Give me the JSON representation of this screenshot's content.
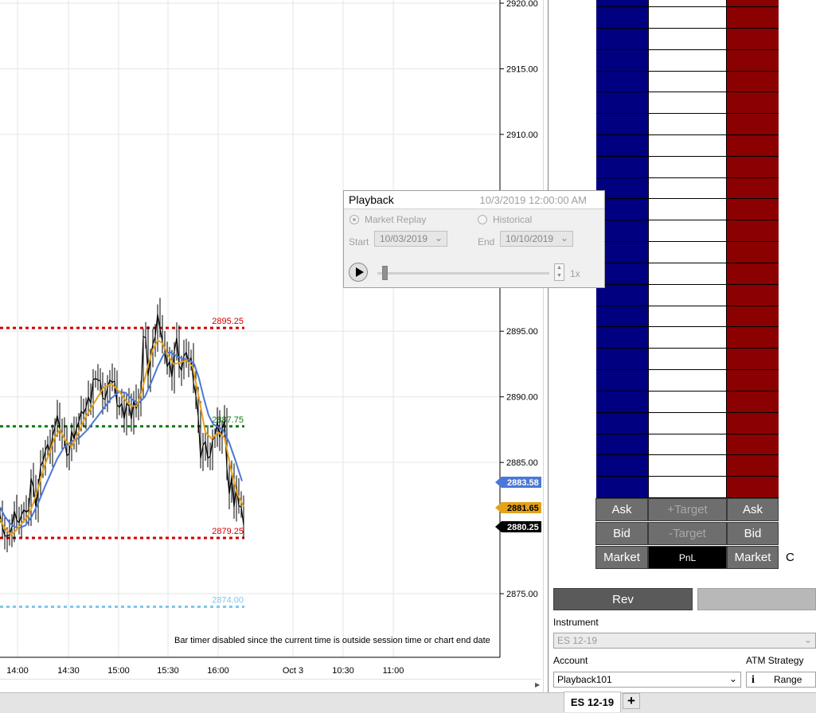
{
  "chart": {
    "price_axis": {
      "min": 2871.0,
      "max": 2920.0,
      "ticks": [
        "2920.00",
        "2915.00",
        "2910.00",
        "2895.00",
        "2890.00",
        "2885.00",
        "2875.00"
      ]
    },
    "time_axis": [
      "14:00",
      "14:30",
      "15:00",
      "15:30",
      "16:00",
      "Oct 3",
      "10:30",
      "11:00"
    ],
    "levels": [
      {
        "label": "2895.25",
        "price": 2895.25,
        "color": "#d40000"
      },
      {
        "label": "2887.75",
        "price": 2887.75,
        "color": "#0f7a0f"
      },
      {
        "label": "2879.25",
        "price": 2879.25,
        "color": "#d40000"
      },
      {
        "label": "2874.00",
        "price": 2874.0,
        "color": "#7ec8f0"
      }
    ],
    "price_tags": [
      {
        "label": "2883.58",
        "price": 2883.58,
        "bg": "#4a78d8",
        "fg": "#ffffff"
      },
      {
        "label": "2881.65",
        "price": 2881.65,
        "bg": "#e3a21a",
        "fg": "#000000"
      },
      {
        "label": "2880.25",
        "price": 2880.25,
        "bg": "#000000",
        "fg": "#ffffff"
      }
    ],
    "bar_timer_note": "Bar timer disabled since the current time is outside session time or chart end date",
    "colors": {
      "price": "#000000",
      "fast_ma": "#e3a21a",
      "slow_ma": "#4a78d8",
      "grid": "#e6e6e6"
    }
  },
  "chart_data": {
    "type": "line",
    "title": "",
    "xlabel": "",
    "ylabel": "",
    "x_ticks": [
      "14:00",
      "14:30",
      "15:00",
      "15:30",
      "16:00",
      "Oct 3",
      "10:30",
      "11:00"
    ],
    "ylim": [
      2871,
      2920
    ],
    "grid": true,
    "series": [
      {
        "key": "price",
        "x": [
          0,
          3,
          6,
          9,
          12,
          15,
          18,
          21,
          24,
          27,
          30,
          33,
          36,
          39,
          42,
          45,
          48,
          51,
          54,
          57,
          60,
          63,
          66,
          69,
          72,
          75,
          78,
          81,
          84,
          87,
          90,
          93,
          96,
          99,
          102,
          105,
          108,
          111,
          114,
          117,
          120,
          123,
          126,
          129,
          132,
          135,
          138,
          141,
          144,
          147,
          150,
          153,
          156,
          159,
          162,
          165,
          168,
          171,
          174,
          177,
          180,
          183,
          186,
          189,
          192,
          195,
          198,
          201,
          204,
          207,
          210,
          213,
          216,
          219,
          222,
          225,
          228,
          231,
          234,
          237,
          240,
          243,
          246,
          249,
          252,
          255,
          258,
          261,
          264,
          267,
          270,
          273,
          276,
          279,
          282,
          285,
          288,
          291,
          294,
          297,
          300,
          303,
          306
        ],
        "values": [
          2881.0,
          2880.1,
          2879.4,
          2879.4,
          2879.5,
          2880.1,
          2881.3,
          2880.6,
          2880.4,
          2881.0,
          2881.4,
          2881.2,
          2881.4,
          2883.8,
          2883.1,
          2881.6,
          2883.0,
          2884.7,
          2885.1,
          2885.9,
          2886.4,
          2885.7,
          2887.0,
          2887.7,
          2888.6,
          2887.6,
          2887.2,
          2886.8,
          2885.5,
          2885.7,
          2887.4,
          2886.8,
          2887.6,
          2888.1,
          2888.9,
          2888.7,
          2889.2,
          2890.0,
          2889.5,
          2891.3,
          2891.4,
          2891.3,
          2891.2,
          2889.9,
          2889.8,
          2890.7,
          2891.3,
          2891.1,
          2891.2,
          2889.4,
          2889.2,
          2889.5,
          2888.3,
          2889.5,
          2889.3,
          2888.3,
          2889.7,
          2889.1,
          2889.6,
          2890.4,
          2894.6,
          2894.5,
          2891.6,
          2893.0,
          2894.0,
          2894.6,
          2896.3,
          2895.2,
          2894.2,
          2893.6,
          2892.3,
          2892.7,
          2891.5,
          2893.5,
          2894.5,
          2892.4,
          2892.0,
          2893.1,
          2893.4,
          2892.6,
          2893.0,
          2891.1,
          2890.1,
          2888.5,
          2885.3,
          2886.3,
          2886.6,
          2885.3,
          2885.5,
          2886.7,
          2887.0,
          2888.1,
          2886.9,
          2887.5,
          2888.2,
          2884.6,
          2882.6,
          2883.9,
          2881.6,
          2883.2,
          2881.7,
          2881.6,
          2880.25
        ]
      },
      {
        "key": "fast_ma",
        "x": [
          0,
          4,
          9,
          14,
          20,
          28,
          35,
          42,
          49,
          55,
          62,
          68,
          75,
          82,
          90,
          98,
          106,
          112,
          120,
          130,
          140,
          150,
          158,
          165,
          172,
          178,
          186,
          192,
          198,
          204,
          210,
          218,
          226,
          234,
          242,
          250,
          258,
          266,
          274,
          282,
          290,
          298,
          306
        ],
        "values": [
          2880.7,
          2880.2,
          2879.8,
          2879.5,
          2879.8,
          2880.4,
          2880.9,
          2881.9,
          2883.3,
          2884.6,
          2885.7,
          2886.8,
          2887.5,
          2886.7,
          2886.2,
          2887.2,
          2888.3,
          2888.9,
          2889.7,
          2890.7,
          2891.0,
          2890.4,
          2889.7,
          2889.3,
          2889.3,
          2890.4,
          2892.4,
          2893.6,
          2894.3,
          2894.1,
          2893.3,
          2892.5,
          2892.6,
          2892.8,
          2892.3,
          2889.9,
          2887.3,
          2886.8,
          2887.3,
          2886.9,
          2884.5,
          2882.6,
          2881.65
        ]
      },
      {
        "key": "slow_ma",
        "x": [
          0,
          6,
          12,
          18,
          24,
          32,
          40,
          48,
          56,
          64,
          72,
          80,
          90,
          100,
          110,
          120,
          130,
          140,
          150,
          158,
          166,
          174,
          182,
          190,
          198,
          206,
          214,
          222,
          230,
          238,
          244,
          250,
          256,
          262,
          268,
          274,
          280,
          288,
          296,
          304
        ],
        "values": [
          2881.6,
          2880.9,
          2880.4,
          2880.1,
          2880.0,
          2880.2,
          2880.9,
          2881.9,
          2883.1,
          2884.2,
          2885.3,
          2886.1,
          2886.6,
          2886.9,
          2887.5,
          2888.3,
          2889.1,
          2889.9,
          2890.4,
          2890.3,
          2889.8,
          2889.5,
          2890.0,
          2891.1,
          2892.3,
          2893.3,
          2893.4,
          2893.1,
          2892.9,
          2892.8,
          2892.5,
          2891.4,
          2889.9,
          2888.6,
          2887.9,
          2887.7,
          2887.5,
          2886.5,
          2885.1,
          2883.58
        ]
      }
    ]
  },
  "playback": {
    "title": "Playback",
    "datetime": "10/3/2019 12:00:00 AM",
    "mode_market_replay": "Market Replay",
    "mode_historical": "Historical",
    "start_label": "Start",
    "start_value": "10/03/2019",
    "end_label": "End",
    "end_value": "10/10/2019",
    "speed": "1x",
    "selected_mode": "Market Replay"
  },
  "dom": {
    "rows": 24,
    "colors": {
      "bid_column": "#000080",
      "ask_column": "#8b0000",
      "button_bg": "#6e6e6e"
    },
    "buttons": {
      "ask_left": "Ask",
      "plus_target": "+Target",
      "ask_right": "Ask",
      "bid_left": "Bid",
      "minus_target": "-Target",
      "bid_right": "Bid",
      "market_left": "Market",
      "pnl": "PnL",
      "market_right": "Market",
      "trailing": "C"
    }
  },
  "order_entry": {
    "rev_label": "Rev",
    "instrument_label": "Instrument",
    "instrument_value": "ES 12-19",
    "account_label": "Account",
    "account_value": "Playback101",
    "atm_label": "ATM Strategy",
    "atm_value": "Range",
    "info_glyph": "i"
  },
  "tabs": {
    "active": "ES 12-19",
    "add": "+"
  }
}
